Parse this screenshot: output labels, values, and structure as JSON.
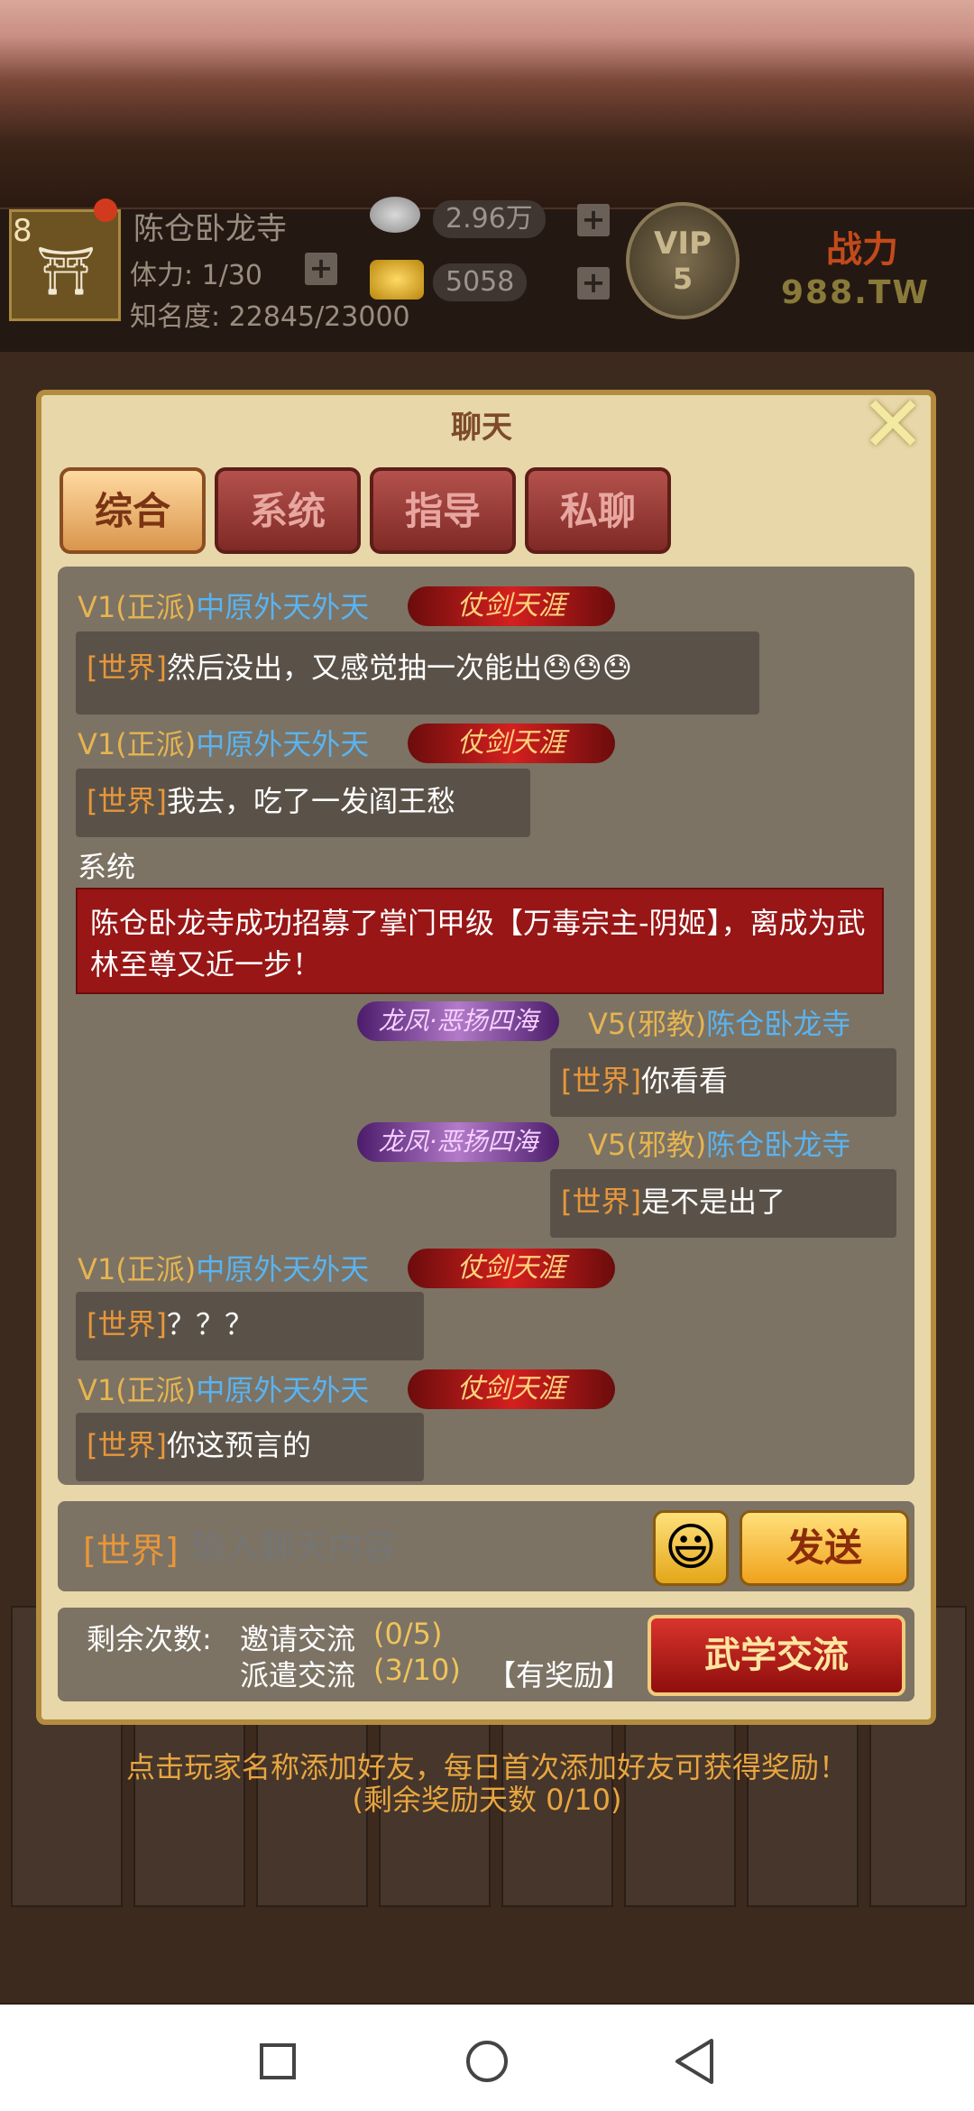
{
  "player": {
    "level": "8",
    "name": "陈仓卧龙寺",
    "stamina": "体力: 1/30",
    "fame": "知名度: 22845/23000"
  },
  "resources": {
    "silver": "2.96万",
    "gold": "5058"
  },
  "vip": {
    "label": "VIP",
    "level": "5"
  },
  "power": {
    "label": "战力",
    "value": "988.TW"
  },
  "chat": {
    "title": "聊天",
    "tabs": [
      "综合",
      "系统",
      "指导",
      "私聊"
    ],
    "messages": [
      {
        "sect": "V1(正派)",
        "name": "中原外天外天",
        "badge": "仗剑天涯",
        "tag": "[世界]",
        "text": "然后没出，又感觉抽一次能出😓😓😓"
      },
      {
        "sect": "V1(正派)",
        "name": "中原外天外天",
        "badge": "仗剑天涯",
        "tag": "[世界]",
        "text": "我去，吃了一发阎王愁"
      },
      {
        "system_label": "系统",
        "system_text": "陈仓卧龙寺成功招募了掌门甲级【万毒宗主-阴姬】，离成为武林至尊又近一步！"
      },
      {
        "sect": "V5(邪教)",
        "name": "陈仓卧龙寺",
        "badge": "龙凤·恶扬四海",
        "tag": "[世界]",
        "text": "你看看"
      },
      {
        "sect": "V5(邪教)",
        "name": "陈仓卧龙寺",
        "badge": "龙凤·恶扬四海",
        "tag": "[世界]",
        "text": "是不是出了"
      },
      {
        "sect": "V1(正派)",
        "name": "中原外天外天",
        "badge": "仗剑天涯",
        "tag": "[世界]",
        "text": "？？？"
      },
      {
        "sect": "V1(正派)",
        "name": "中原外天外天",
        "badge": "仗剑天涯",
        "tag": "[世界]",
        "text": "你这预言的"
      }
    ],
    "input_prefix": "[世界]",
    "input_placeholder": "输入聊天内容",
    "send_label": "发送"
  },
  "exchange": {
    "remaining_label": "剩余次数:",
    "invite_label": "邀请交流",
    "invite_value": "(0/5)",
    "dispatch_label": "派遣交流",
    "dispatch_value": "(3/10)",
    "reward_label": "【有奖励】",
    "button_label": "武学交流"
  },
  "notice": {
    "line1": "点击玩家名称添加好友，每日首次添加好友可获得奖励！",
    "line2": "(剩余奖励天数 0/10)"
  },
  "colors": {
    "panel": "#e8d7a9",
    "chat_bg": "#7c7364",
    "bubble_bg": "#5a5248",
    "world_tag": "#e8963a",
    "name_blue": "#5ab3f0",
    "system_red": "#981616"
  }
}
